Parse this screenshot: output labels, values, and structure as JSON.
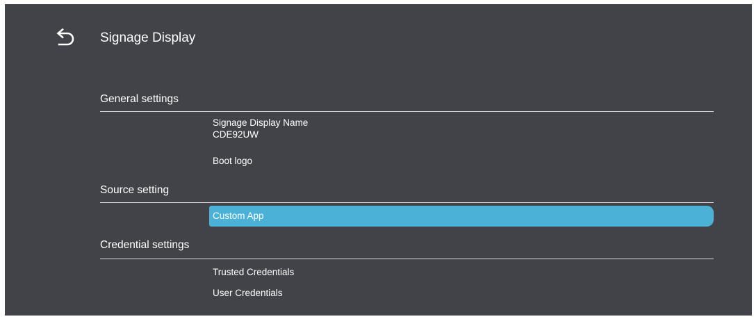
{
  "header": {
    "title": "Signage Display",
    "back_icon": "back-arrow-icon"
  },
  "sections": {
    "general": {
      "label": "General settings",
      "items": [
        {
          "label": "Signage Display Name",
          "value": "CDE92UW"
        },
        {
          "label": "Boot logo"
        }
      ]
    },
    "source": {
      "label": "Source setting",
      "items": [
        {
          "label": "Custom App",
          "selected": true
        }
      ]
    },
    "credential": {
      "label": "Credential settings",
      "items": [
        {
          "label": "Trusted Credentials"
        },
        {
          "label": "User Credentials"
        }
      ]
    }
  },
  "colors": {
    "background": "#414349",
    "highlight": "#4bb1d6",
    "divider": "#d9d9da",
    "text": "#ffffff"
  }
}
